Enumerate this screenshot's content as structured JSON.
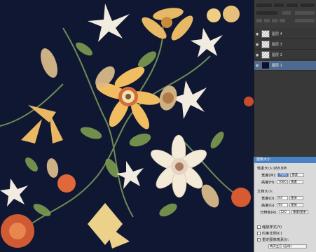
{
  "app": "Photoshop",
  "layers_panel": {
    "rows": [
      {
        "name": "图层 4",
        "thumb": "checker",
        "visible": true
      },
      {
        "name": "图层 3",
        "thumb": "checker",
        "visible": true
      },
      {
        "name": "图层 2",
        "thumb": "checker",
        "visible": true
      },
      {
        "name": "图层 1",
        "thumb": "dark",
        "visible": true,
        "active": true
      }
    ]
  },
  "image_size_dialog": {
    "title": "图像大小",
    "pixel_dimensions": "像素大小:168.8M",
    "width_label": "宽度(W):",
    "width_value": "7680",
    "height_label": "高度(H):",
    "height_value": "7680",
    "unit_pixels": "像素",
    "document_size": "文档大小:",
    "doc_width_label": "宽度(D):",
    "doc_width_value": "64",
    "doc_height_label": "高度(G):",
    "doc_height_value": "64",
    "unit_cm": "厘米",
    "resolution_label": "分辨率(R):",
    "resolution_value": "120",
    "unit_resolution": "像素/厘米",
    "scale_styles": "缩放样式(Y)",
    "constrain_proportions": "约束比例(C)",
    "resample": "重定图像像素(I):",
    "resample_method": "两次立方 (自动)"
  },
  "colors": {
    "artwork_background": "#0f1733",
    "panel_bg": "#383838",
    "active_layer": "#4e6a8e",
    "dialog_bg": "#d9d9d9",
    "dialog_title": "#4a82c6"
  }
}
